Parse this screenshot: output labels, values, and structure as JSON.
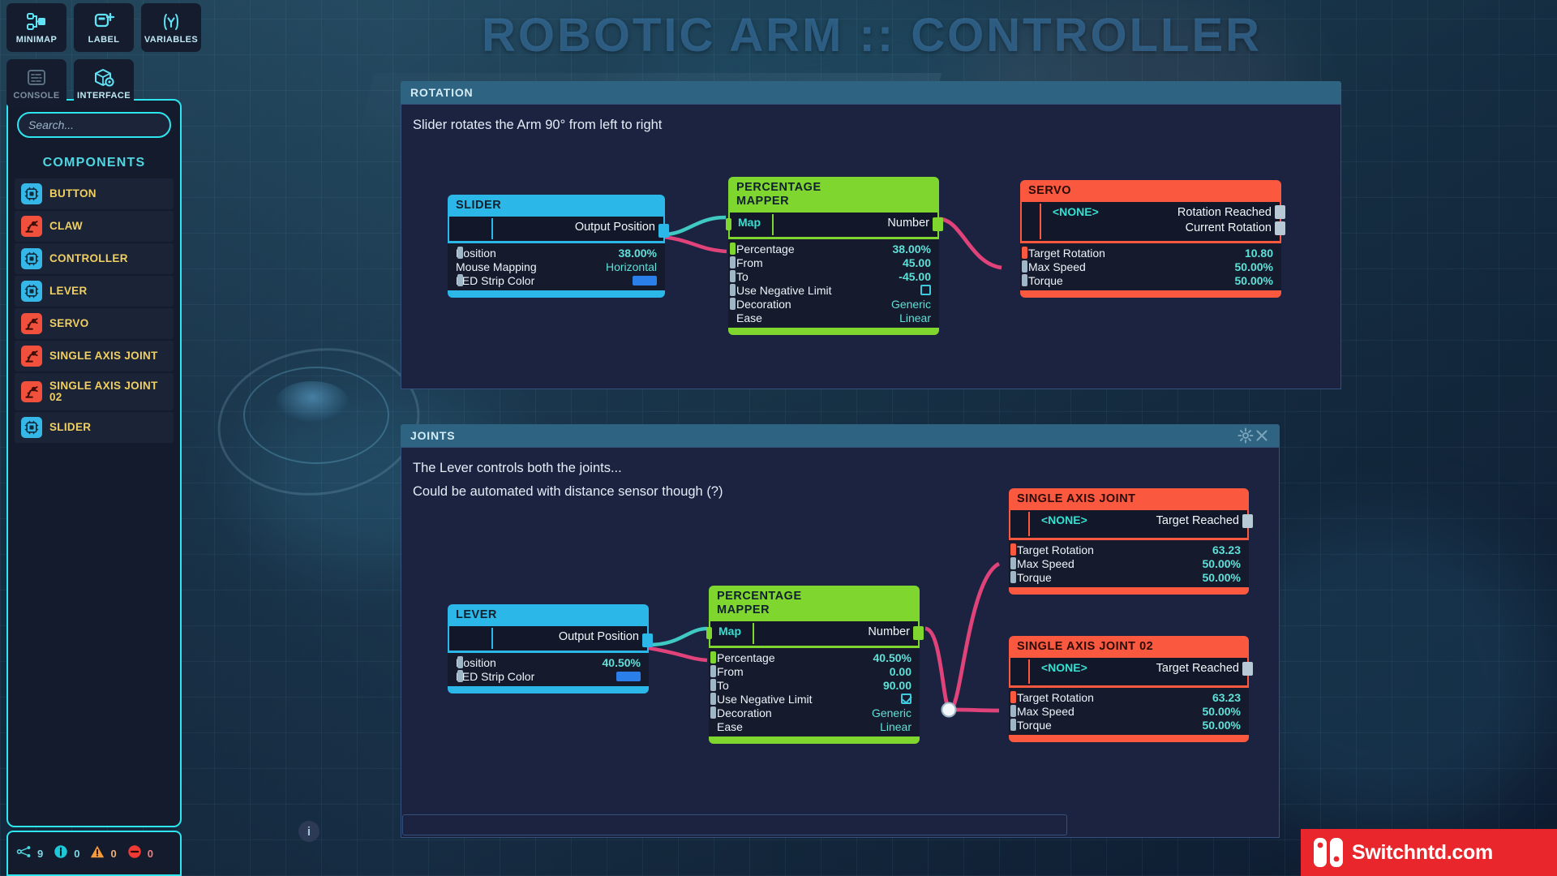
{
  "title_banner": "ROBOTIC ARM :: CONTROLLER",
  "toolbar": [
    {
      "label": "MINIMAP",
      "icon": "minimap-icon",
      "active": true
    },
    {
      "label": "LABEL",
      "icon": "label-plus-icon",
      "active": true
    },
    {
      "label": "VARIABLES",
      "icon": "variables-icon",
      "active": true
    },
    {
      "label": "CONSOLE",
      "icon": "console-icon",
      "active": false
    },
    {
      "label": "INTERFACE",
      "icon": "interface-icon",
      "active": true
    }
  ],
  "sidebar": {
    "search_placeholder": "Search...",
    "search_value": "",
    "components_title": "COMPONENTS",
    "components": [
      {
        "label": "BUTTON",
        "icon": "chip-icon",
        "color": "blue"
      },
      {
        "label": "CLAW",
        "icon": "robot-arm-icon",
        "color": "red"
      },
      {
        "label": "CONTROLLER",
        "icon": "chip-icon",
        "color": "blue"
      },
      {
        "label": "LEVER",
        "icon": "chip-icon",
        "color": "blue"
      },
      {
        "label": "SERVO",
        "icon": "robot-arm-icon",
        "color": "red"
      },
      {
        "label": "SINGLE AXIS JOINT",
        "icon": "robot-arm-icon",
        "color": "red"
      },
      {
        "label": "SINGLE AXIS JOINT 02",
        "icon": "robot-arm-icon",
        "color": "red"
      },
      {
        "label": "SLIDER",
        "icon": "chip-icon",
        "color": "blue"
      }
    ]
  },
  "statusbar": {
    "nodes_icon": "node-graph-icon",
    "nodes_count": "9",
    "info_icon": "info-icon",
    "info_count": "0",
    "warning_icon": "warning-icon",
    "warning_count": "0",
    "error_icon": "error-icon",
    "error_count": "0"
  },
  "panels": [
    {
      "title": "ROTATION",
      "note": "Slider rotates the Arm 90° from left to right",
      "has_gear": false,
      "has_close": false
    },
    {
      "title": "JOINTS",
      "note_line1": "The Lever controls both the joints...",
      "note_line2": "Could be automated with distance sensor though (?)",
      "gear_icon": "gear-icon",
      "close_icon": "close-icon",
      "has_gear": true,
      "has_close": true
    }
  ],
  "nodes": {
    "slider": {
      "title": "SLIDER",
      "out_label": "Output Position",
      "props": [
        {
          "name": "Position",
          "value": "38.00%",
          "type": "num"
        },
        {
          "name": "Mouse Mapping",
          "value": "Horizontal",
          "type": "word"
        },
        {
          "name": "LED Strip Color",
          "value": "#2a7fe8",
          "type": "color"
        }
      ]
    },
    "mapper1": {
      "title_line1": "PERCENTAGE",
      "title_line2": "MAPPER",
      "in_label": "Map",
      "out_label": "Number",
      "props": [
        {
          "name": "Percentage",
          "value": "38.00%",
          "type": "num"
        },
        {
          "name": "From",
          "value": "45.00",
          "type": "num"
        },
        {
          "name": "To",
          "value": "-45.00",
          "type": "num"
        },
        {
          "name": "Use Negative Limit",
          "value": "false",
          "type": "check"
        },
        {
          "name": "Decoration",
          "value": "Generic",
          "type": "word"
        },
        {
          "name": "Ease",
          "value": "Linear",
          "type": "word"
        }
      ]
    },
    "servo": {
      "title": "SERVO",
      "in_label": "<NONE>",
      "out_line1": "Rotation Reached",
      "out_line2": "Current Rotation",
      "props": [
        {
          "name": "Target Rotation",
          "value": "10.80",
          "type": "num"
        },
        {
          "name": "Max Speed",
          "value": "50.00%",
          "type": "num"
        },
        {
          "name": "Torque",
          "value": "50.00%",
          "type": "num"
        }
      ]
    },
    "lever": {
      "title": "LEVER",
      "out_label": "Output Position",
      "props": [
        {
          "name": "Position",
          "value": "40.50%",
          "type": "num"
        },
        {
          "name": "LED Strip Color",
          "value": "#2a7fe8",
          "type": "color"
        }
      ]
    },
    "mapper2": {
      "title_line1": "PERCENTAGE",
      "title_line2": "MAPPER",
      "in_label": "Map",
      "out_label": "Number",
      "props": [
        {
          "name": "Percentage",
          "value": "40.50%",
          "type": "num"
        },
        {
          "name": "From",
          "value": "0.00",
          "type": "num"
        },
        {
          "name": "To",
          "value": "90.00",
          "type": "num"
        },
        {
          "name": "Use Negative Limit",
          "value": "true",
          "type": "check"
        },
        {
          "name": "Decoration",
          "value": "Generic",
          "type": "word"
        },
        {
          "name": "Ease",
          "value": "Linear",
          "type": "word"
        }
      ]
    },
    "joint1": {
      "title": "SINGLE AXIS JOINT",
      "in_label": "<NONE>",
      "out_label": "Target Reached",
      "props": [
        {
          "name": "Target Rotation",
          "value": "63.23",
          "type": "num"
        },
        {
          "name": "Max Speed",
          "value": "50.00%",
          "type": "num"
        },
        {
          "name": "Torque",
          "value": "50.00%",
          "type": "num"
        }
      ]
    },
    "joint2": {
      "title": "SINGLE AXIS JOINT 02",
      "in_label": "<NONE>",
      "out_label": "Target Reached",
      "props": [
        {
          "name": "Target Rotation",
          "value": "63.23",
          "type": "num"
        },
        {
          "name": "Max Speed",
          "value": "50.00%",
          "type": "num"
        },
        {
          "name": "Torque",
          "value": "50.00%",
          "type": "num"
        }
      ]
    }
  },
  "canvas": {
    "info_label": "i"
  },
  "watermark": {
    "text": "Switchntd.com"
  },
  "colors": {
    "cyan": "#2bb8e8",
    "green": "#7ed62f",
    "red": "#fb5840",
    "wire_pink": "#e0427a",
    "wire_teal": "#3fc9c2",
    "accent": "#2ee6ef",
    "label_yellow": "#f0cf63"
  }
}
